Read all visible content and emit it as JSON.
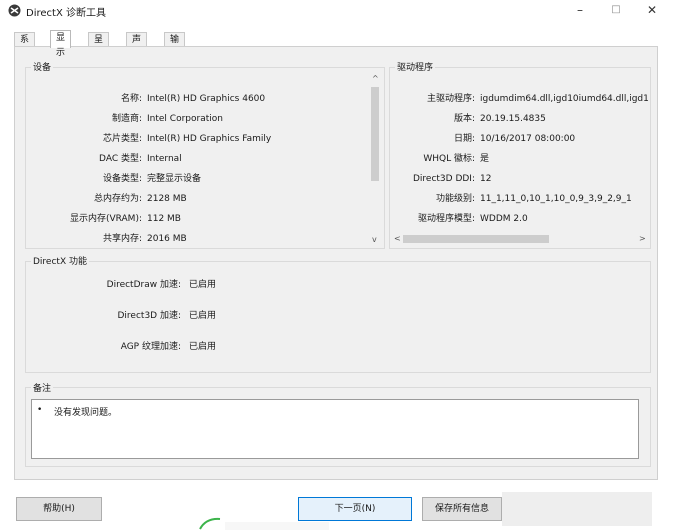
{
  "window": {
    "title": "DirectX 诊断工具",
    "minimize": "–",
    "maximize": "□",
    "close": "✕"
  },
  "tabs": [
    {
      "label": "系统",
      "active": false
    },
    {
      "label": "显示",
      "active": true
    },
    {
      "label": "呈现",
      "active": false
    },
    {
      "label": "声音",
      "active": false
    },
    {
      "label": "输入",
      "active": false
    }
  ],
  "device": {
    "title": "设备",
    "rows": [
      {
        "label": "名称:",
        "value": "Intel(R) HD Graphics 4600"
      },
      {
        "label": "制造商:",
        "value": "Intel Corporation"
      },
      {
        "label": "芯片类型:",
        "value": "Intel(R) HD Graphics Family"
      },
      {
        "label": "DAC 类型:",
        "value": "Internal"
      },
      {
        "label": "设备类型:",
        "value": "完整显示设备"
      },
      {
        "label": "总内存约为:",
        "value": "2128 MB"
      },
      {
        "label": "显示内存(VRAM):",
        "value": "112 MB"
      },
      {
        "label": "共享内存:",
        "value": "2016 MB"
      }
    ]
  },
  "drivers": {
    "title": "驱动程序",
    "rows": [
      {
        "label": "主驱动程序:",
        "value": "igdumdim64.dll,igd10iumd64.dll,igd1"
      },
      {
        "label": "版本:",
        "value": "20.19.15.4835"
      },
      {
        "label": "日期:",
        "value": "10/16/2017 08:00:00"
      },
      {
        "label": "WHQL 徽标:",
        "value": "是"
      },
      {
        "label": "Direct3D DDI:",
        "value": "12"
      },
      {
        "label": "功能级别:",
        "value": "11_1,11_0,10_1,10_0,9_3,9_2,9_1"
      },
      {
        "label": "驱动程序模型:",
        "value": "WDDM 2.0"
      }
    ]
  },
  "features": {
    "title": "DirectX 功能",
    "rows": [
      {
        "label": "DirectDraw 加速:",
        "value": "已启用"
      },
      {
        "label": "Direct3D 加速:",
        "value": "已启用"
      },
      {
        "label": "AGP 纹理加速:",
        "value": "已启用"
      }
    ]
  },
  "notes": {
    "title": "备注",
    "bullet": "•",
    "text": "没有发现问题。"
  },
  "scroll_glyphs": {
    "up": "^",
    "down": "v",
    "left": "<",
    "right": ">"
  },
  "buttons": {
    "help": "帮助(H)",
    "next": "下一页(N)",
    "save": "保存所有信息"
  }
}
